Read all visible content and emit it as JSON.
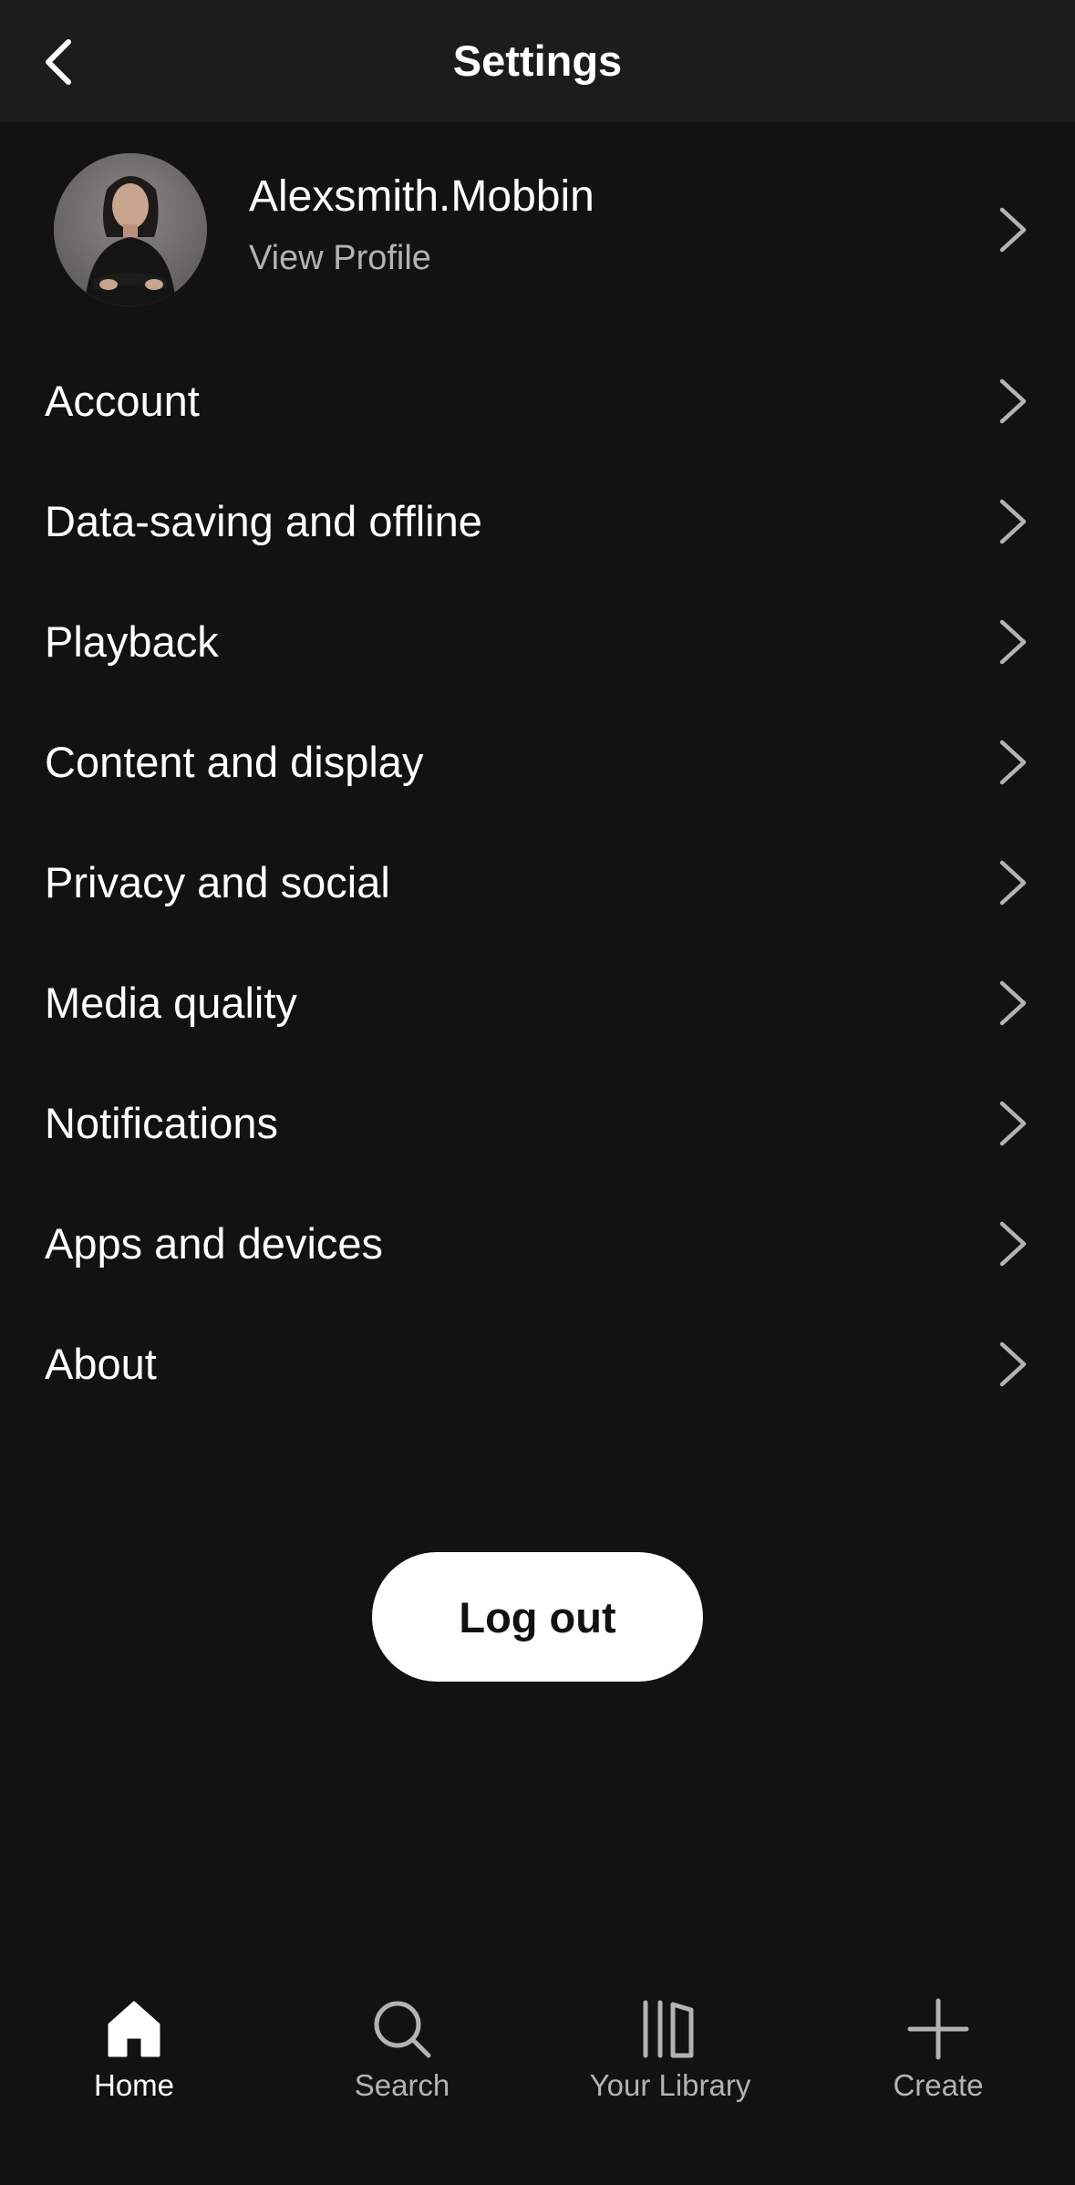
{
  "header": {
    "title": "Settings",
    "back_icon": "chevron-left-icon"
  },
  "profile": {
    "name": "Alexsmith.Mobbin",
    "subtitle": "View Profile"
  },
  "menu": [
    {
      "label": "Account"
    },
    {
      "label": "Data-saving and offline"
    },
    {
      "label": "Playback"
    },
    {
      "label": "Content and display"
    },
    {
      "label": "Privacy and social"
    },
    {
      "label": "Media quality"
    },
    {
      "label": "Notifications"
    },
    {
      "label": "Apps and devices"
    },
    {
      "label": "About"
    }
  ],
  "logout": {
    "label": "Log out"
  },
  "bottom_nav": [
    {
      "label": "Home",
      "icon": "home-icon",
      "active": true
    },
    {
      "label": "Search",
      "icon": "search-icon",
      "active": false
    },
    {
      "label": "Your Library",
      "icon": "library-icon",
      "active": false
    },
    {
      "label": "Create",
      "icon": "plus-icon",
      "active": false
    }
  ],
  "colors": {
    "background": "#121212",
    "header": "#1c1c1c",
    "text_primary": "#ffffff",
    "text_secondary": "#b3b3b3",
    "button": "#ffffff"
  }
}
